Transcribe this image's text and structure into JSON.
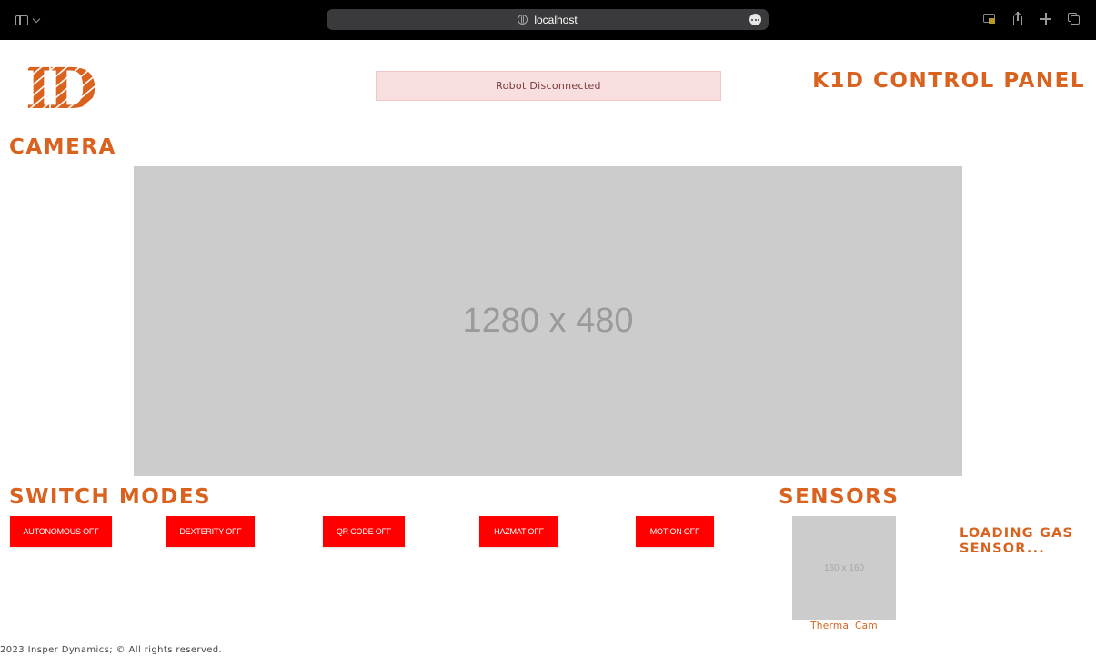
{
  "browser": {
    "url": "localhost"
  },
  "header": {
    "logo_text": "ID",
    "status": "Robot Disconnected",
    "panel_title": "K1D CONTROL PANEL"
  },
  "camera": {
    "heading": "CAMERA",
    "placeholder_text": "1280 x 480"
  },
  "modes": {
    "heading": "SWITCH MODES",
    "buttons": [
      {
        "label": "AUTONOMOUS OFF"
      },
      {
        "label": "DEXTERITY OFF"
      },
      {
        "label": "QR CODE OFF"
      },
      {
        "label": "HAZMAT OFF"
      },
      {
        "label": "MOTION OFF"
      }
    ]
  },
  "sensors": {
    "heading": "SENSORS",
    "thermal_placeholder": "160 x 160",
    "thermal_label": "Thermal Cam",
    "gas_status": "LOADING GAS SENSOR..."
  },
  "footer": {
    "text": "2023 Insper Dynamics; © All rights reserved."
  },
  "colors": {
    "accent": "#d9621f",
    "button_bg": "#ff0000",
    "status_bg": "#f8dede",
    "placeholder_bg": "#cccccc",
    "chrome_bg": "#000000"
  }
}
